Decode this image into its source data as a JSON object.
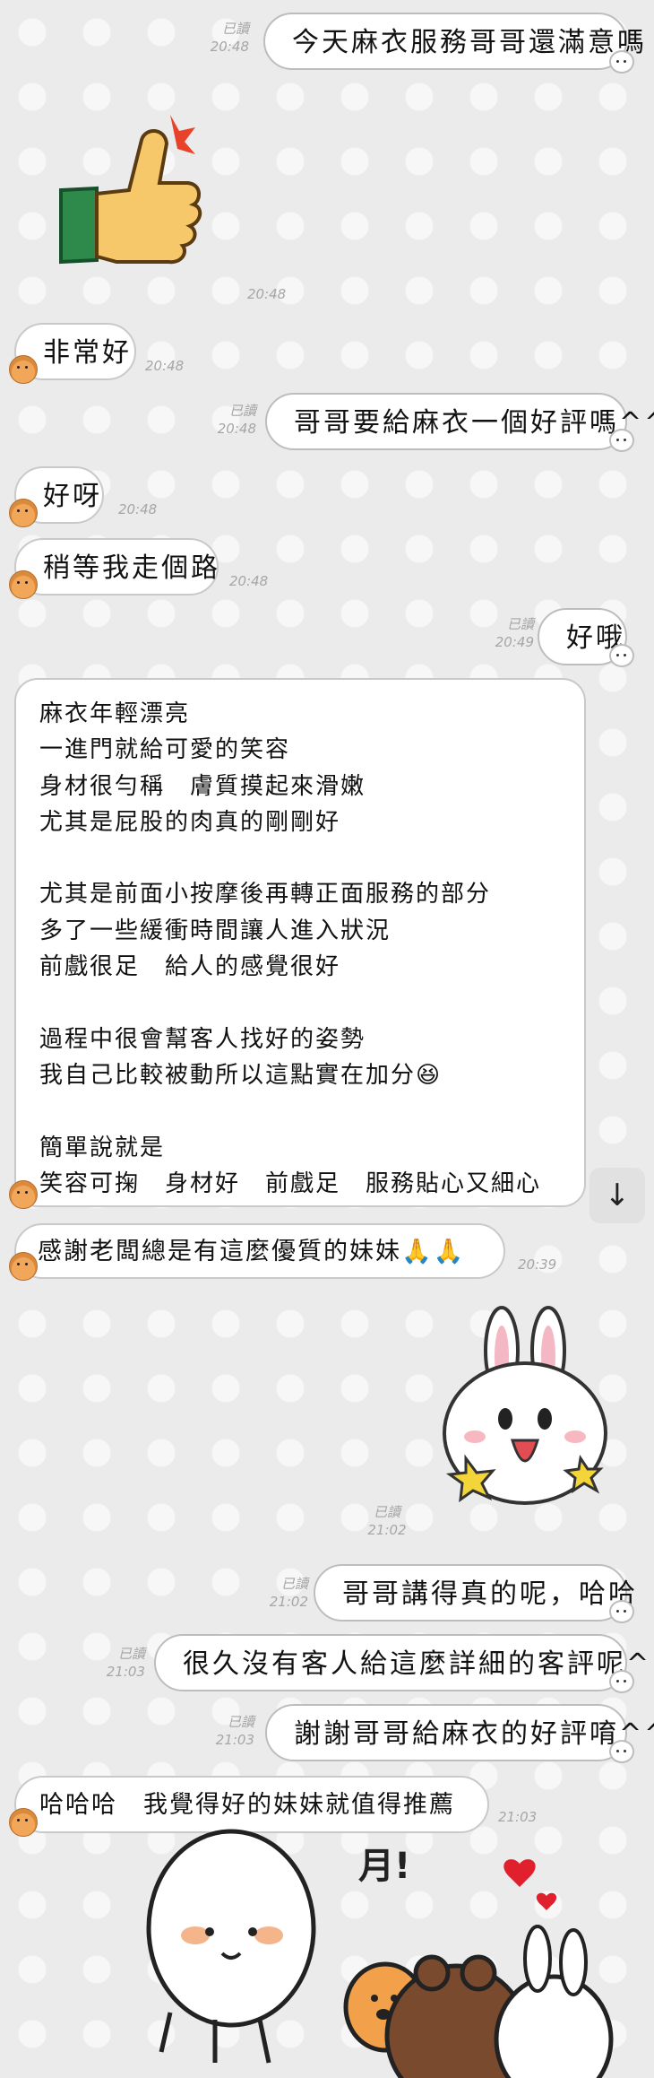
{
  "colors": {
    "background": "#ebebeb",
    "bubble": "#ffffff",
    "bubble_border": "#c9c9c9",
    "timestamp": "#a6a6a6",
    "avatar": "#f1a65a"
  },
  "messages": [
    {
      "from": "me",
      "text": "今天麻衣服務哥哥還滿意嗎",
      "read": "已讀",
      "time": "20:48"
    },
    {
      "from": "them",
      "sticker": "thumbs-up-sticker",
      "time": "20:48"
    },
    {
      "from": "them",
      "text": "非常好",
      "time": "20:48"
    },
    {
      "from": "me",
      "text": "哥哥要給麻衣一個好評嗎^^",
      "read": "已讀",
      "time": "20:48"
    },
    {
      "from": "them",
      "text": "好呀",
      "time": "20:48"
    },
    {
      "from": "them",
      "text": "稍等我走個路",
      "time": "20:48"
    },
    {
      "from": "me",
      "text": "好哦",
      "read": "已讀",
      "time": "20:49"
    },
    {
      "from": "them",
      "text": "麻衣年輕漂亮\n一進門就給可愛的笑容\n身材很勻稱　膚質摸起來滑嫩\n尤其是屁股的肉真的剛剛好\n\n尤其是前面小按摩後再轉正面服務的部分\n多了一些緩衝時間讓人進入狀況\n前戲很足　給人的感覺很好\n\n過程中很會幫客人找好的姿勢\n我自己比較被動所以這點實在加分😆\n\n簡單說就是\n笑容可掬　身材好　前戲足　服務貼心又細心"
    },
    {
      "from": "them",
      "text": "感謝老闆總是有這麼優質的妹妹🙏🙏",
      "time": "20:39"
    },
    {
      "from": "me",
      "sticker": "bunny-sticker",
      "read": "已讀",
      "time": "21:02"
    },
    {
      "from": "me",
      "text": "哥哥講得真的呢，哈哈",
      "read": "已讀",
      "time": "21:02"
    },
    {
      "from": "me",
      "text": "很久沒有客人給這麼詳細的客評呢^^",
      "read": "已讀",
      "time": "21:03"
    },
    {
      "from": "me",
      "text": "謝謝哥哥給麻衣的好評唷^^",
      "read": "已讀",
      "time": "21:03"
    },
    {
      "from": "them",
      "text": "哈哈哈　我覺得好的妹妹就值得推薦",
      "time": "21:03"
    },
    {
      "from": "them",
      "sticker": "group-hug-sticker",
      "sticker_text": "月!"
    }
  ],
  "scroll_button": {
    "icon": "arrow-down-icon",
    "glyph": "↓"
  }
}
